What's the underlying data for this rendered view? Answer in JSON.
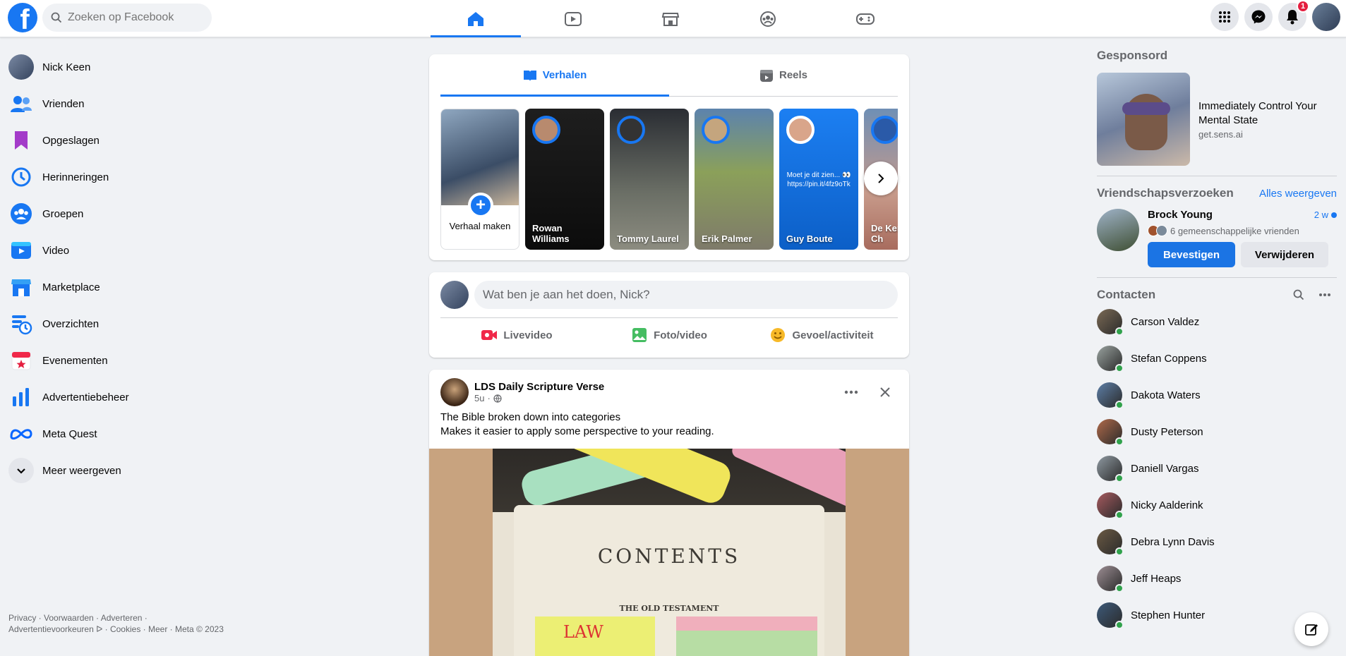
{
  "header": {
    "logo_letter": "f",
    "search_placeholder": "Zoeken op Facebook",
    "notification_count": "1",
    "nav_icons": [
      "home-icon",
      "video-icon",
      "marketplace-icon",
      "groups-icon",
      "gaming-icon"
    ]
  },
  "left": {
    "items": [
      {
        "label": "Nick Keen"
      },
      {
        "label": "Vrienden"
      },
      {
        "label": "Opgeslagen"
      },
      {
        "label": "Herinneringen"
      },
      {
        "label": "Groepen"
      },
      {
        "label": "Video"
      },
      {
        "label": "Marketplace"
      },
      {
        "label": "Overzichten"
      },
      {
        "label": "Evenementen"
      },
      {
        "label": "Advertentiebeheer"
      },
      {
        "label": "Meta Quest"
      },
      {
        "label": "Meer weergeven"
      }
    ],
    "footer": "Privacy · Voorwaarden · Adverteren · Advertentievoorkeuren ᐅ · Cookies · Meer · Meta © 2023"
  },
  "stories": {
    "tab_stories": "Verhalen",
    "tab_reels": "Reels",
    "create_label": "Verhaal maken",
    "items": [
      {
        "name": "Rowan Williams",
        "bg": "#1a1a1a"
      },
      {
        "name": "Tommy Laurel",
        "bg": "#5a5f56"
      },
      {
        "name": "Erik Palmer",
        "bg": "#6f8a4a"
      },
      {
        "name": "Guy Boute",
        "bg": "#1877f2",
        "text": "Moet je dit zien... 👀 https://pin.it/4fz9oTk"
      },
      {
        "name": "De Kerk Jezus Ch",
        "bg": "#b58f7a"
      }
    ]
  },
  "composer": {
    "placeholder": "Wat ben je aan het doen, Nick?",
    "live": "Livevideo",
    "photo": "Foto/video",
    "feeling": "Gevoel/activiteit"
  },
  "post": {
    "author": "LDS Daily Scripture Verse",
    "time": "5u",
    "line1": "The Bible broken down into categories",
    "line2": "Makes it easier to apply some perspective to your reading.",
    "image_title": "CONTENTS",
    "image_sub": "THE OLD TESTAMENT",
    "image_law": "LAW"
  },
  "right": {
    "sponsored": "Gesponsord",
    "ad_title": "Immediately Control Your Mental State",
    "ad_domain": "get.sens.ai",
    "requests_title": "Vriendschapsverzoeken",
    "requests_link": "Alles weergeven",
    "request": {
      "name": "Brock Young",
      "time": "2 w",
      "mutual": "6 gemeenschappelijke vrienden",
      "confirm": "Bevestigen",
      "delete": "Verwijderen"
    },
    "contacts_title": "Contacten",
    "contacts": [
      {
        "name": "Carson Valdez",
        "color": "#7b6a55"
      },
      {
        "name": "Stefan Coppens",
        "color": "#9aa3a0"
      },
      {
        "name": "Dakota Waters",
        "color": "#5d7fa8"
      },
      {
        "name": "Dusty Peterson",
        "color": "#b06a4a"
      },
      {
        "name": "Daniell Vargas",
        "color": "#8f9aa2"
      },
      {
        "name": "Nicky Aalderink",
        "color": "#a75a5f"
      },
      {
        "name": "Debra Lynn Davis",
        "color": "#6b5a44"
      },
      {
        "name": "Jeff Heaps",
        "color": "#9d8e94"
      },
      {
        "name": "Stephen Hunter",
        "color": "#3d5a7a"
      }
    ]
  }
}
